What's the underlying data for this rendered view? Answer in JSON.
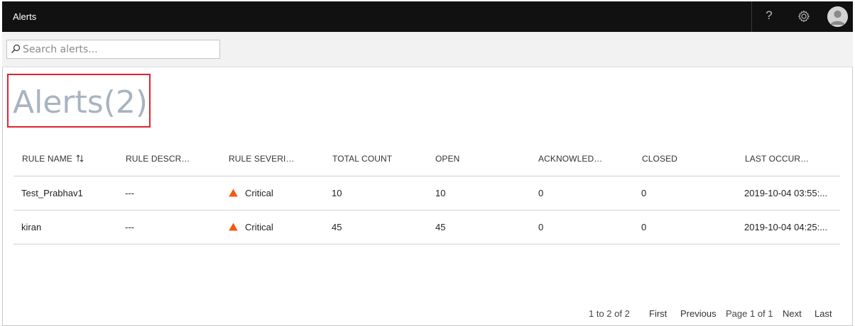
{
  "topbar": {
    "title": "Alerts",
    "help_glyph": "?",
    "icons": [
      "help-icon",
      "gear-icon",
      "avatar-icon"
    ]
  },
  "search": {
    "placeholder": "Search alerts...",
    "value": ""
  },
  "page": {
    "heading": "Alerts(2)"
  },
  "table": {
    "columns": [
      "RULE NAME",
      "RULE DESCR…",
      "RULE SEVERI…",
      "TOTAL COUNT",
      "OPEN",
      "ACKNOWLED…",
      "CLOSED",
      "LAST OCCUR…"
    ],
    "rows": [
      {
        "rule_name": "Test_Prabhav1",
        "description": "---",
        "severity": "Critical",
        "total_count": "10",
        "open": "10",
        "acknowledged": "0",
        "closed": "0",
        "last_occurrence": "2019-10-04 03:55:..."
      },
      {
        "rule_name": "kiran",
        "description": "---",
        "severity": "Critical",
        "total_count": "45",
        "open": "45",
        "acknowledged": "0",
        "closed": "0",
        "last_occurrence": "2019-10-04 04:25:..."
      }
    ]
  },
  "pager": {
    "range": "1 to 2 of 2",
    "first": "First",
    "previous": "Previous",
    "page": "Page 1 of 1",
    "next": "Next",
    "last": "Last"
  },
  "colors": {
    "topbar": "#111111",
    "heading_text": "#a8b4c0",
    "highlight_border": "#e0242e",
    "critical": "#f25a12"
  }
}
